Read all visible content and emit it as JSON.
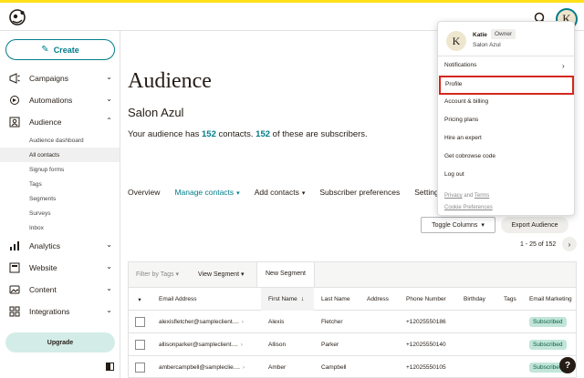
{
  "colors": {
    "brand_yellow": "#ffe01b",
    "accent": "#007c89",
    "highlight_outline": "#d4271d",
    "subscribed_badge": "#c1e6d9"
  },
  "topbar": {
    "search_icon": "search-icon",
    "avatar_initial": "K"
  },
  "sidebar": {
    "create_label": "Create",
    "items": [
      {
        "label": "Campaigns",
        "icon": "campaigns-icon"
      },
      {
        "label": "Automations",
        "icon": "automations-icon"
      },
      {
        "label": "Audience",
        "icon": "audience-icon"
      }
    ],
    "audience_sub": [
      "Audience dashboard",
      "All contacts",
      "Signup forms",
      "Tags",
      "Segments",
      "Surveys",
      "Inbox"
    ],
    "items_after": [
      {
        "label": "Analytics",
        "icon": "analytics-icon"
      },
      {
        "label": "Website",
        "icon": "website-icon"
      },
      {
        "label": "Content",
        "icon": "content-icon"
      },
      {
        "label": "Integrations",
        "icon": "integrations-icon"
      }
    ],
    "upgrade_label": "Upgrade"
  },
  "main": {
    "title": "Audience",
    "audience_name": "Salon Azul",
    "summary": {
      "prefix": "Your audience has ",
      "contacts": "152",
      "middle": " contacts. ",
      "subscribers": "152",
      "suffix": " of these are subscribers."
    },
    "tabs": [
      "Overview",
      "Manage contacts",
      "Add contacts",
      "Subscriber preferences",
      "Settings"
    ],
    "toggle_columns_label": "Toggle Columns",
    "export_label": "Export Audience",
    "pagination": "1 - 25 of 152",
    "filter": {
      "tags_label": "Filter by Tags",
      "view_segment_label": "View Segment",
      "new_segment_label": "New Segment"
    },
    "table": {
      "headers": [
        "Email Address",
        "First Name",
        "Last Name",
        "Address",
        "Phone Number",
        "Birthday",
        "Tags",
        "Email Marketing"
      ],
      "rows": [
        {
          "email": "alexisfletcher@sampleclient....",
          "first": "Alexis",
          "last": "Fletcher",
          "phone": "+12025550186",
          "status": "Subscribed"
        },
        {
          "email": "allisonparker@sampleclient....",
          "first": "Allison",
          "last": "Parker",
          "phone": "+12025550140",
          "status": "Subscribed"
        },
        {
          "email": "ambercampbell@sampleclie....",
          "first": "Amber",
          "last": "Campbell",
          "phone": "+12025550105",
          "status": "Subscribed"
        }
      ]
    }
  },
  "account_menu": {
    "avatar_initial": "K",
    "name": "Katie",
    "role": "Owner",
    "org": "Salon Azul",
    "items": [
      "Notifications",
      "Profile",
      "Account & billing",
      "Pricing plans",
      "Hire an expert",
      "Get cobrowse code",
      "Log out"
    ],
    "highlighted_item": "Profile",
    "privacy": "Privacy",
    "and": " and ",
    "terms": "Terms",
    "cookie": "Cookie Preferences"
  },
  "help_label": "?"
}
